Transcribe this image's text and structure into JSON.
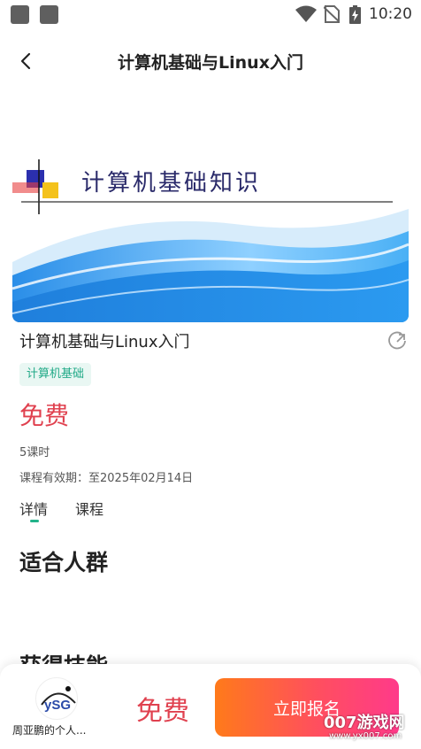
{
  "status_bar": {
    "time": "10:20",
    "icons": [
      "wifi-icon",
      "no-sim-icon",
      "battery-charging-icon"
    ]
  },
  "header": {
    "back_icon": "chevron-left-icon",
    "title": "计算机基础与Linux入门"
  },
  "banner": {
    "text": "计算机基础知识"
  },
  "course": {
    "name": "计算机基础与Linux入门",
    "share_icon": "share-icon",
    "tag": "计算机基础",
    "price": "免费",
    "hours": "5课时",
    "validity": "课程有效期：至2025年02月14日"
  },
  "tabs": [
    {
      "label": "详情",
      "active": true
    },
    {
      "label": "课程",
      "active": false
    }
  ],
  "sections": {
    "audience": "适合人群",
    "skills": "获得技能"
  },
  "bottom_bar": {
    "author": "周亚鹏的个人...",
    "avatar_text": "ySG",
    "price": "免费",
    "enroll_label": "立即报名"
  },
  "watermark": {
    "brand": "007游戏网",
    "url": "www.yx007.com"
  },
  "colors": {
    "accent_red": "#e0414f",
    "tag_green": "#22aa88",
    "button_gradient_start": "#ff7a1a",
    "button_gradient_end": "#ff3a8a"
  }
}
